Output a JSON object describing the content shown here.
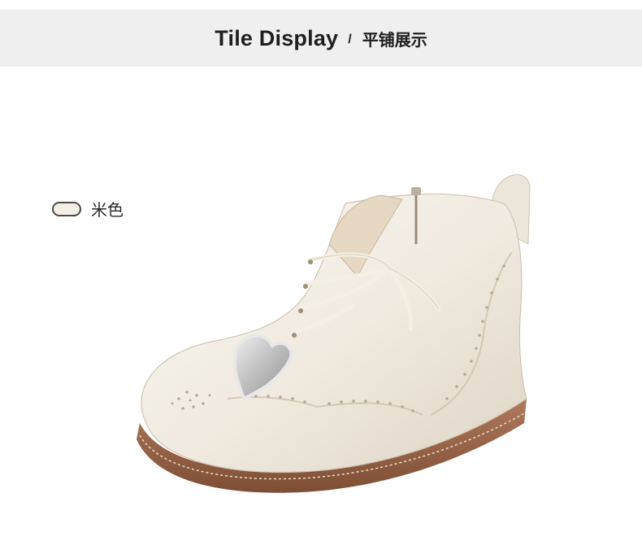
{
  "header": {
    "title_en": "Tile Display",
    "separator": "/",
    "title_cn": "平铺展示"
  },
  "color_option": {
    "label": "米色",
    "swatch_color": "#f3efe6"
  },
  "product_image": {
    "icon": "ankle-boot-illustration",
    "colors": {
      "leather": "#f1ece2",
      "sole": "#9a6549",
      "glitter": "#c9c9c9",
      "lace": "#f4efe3"
    }
  }
}
